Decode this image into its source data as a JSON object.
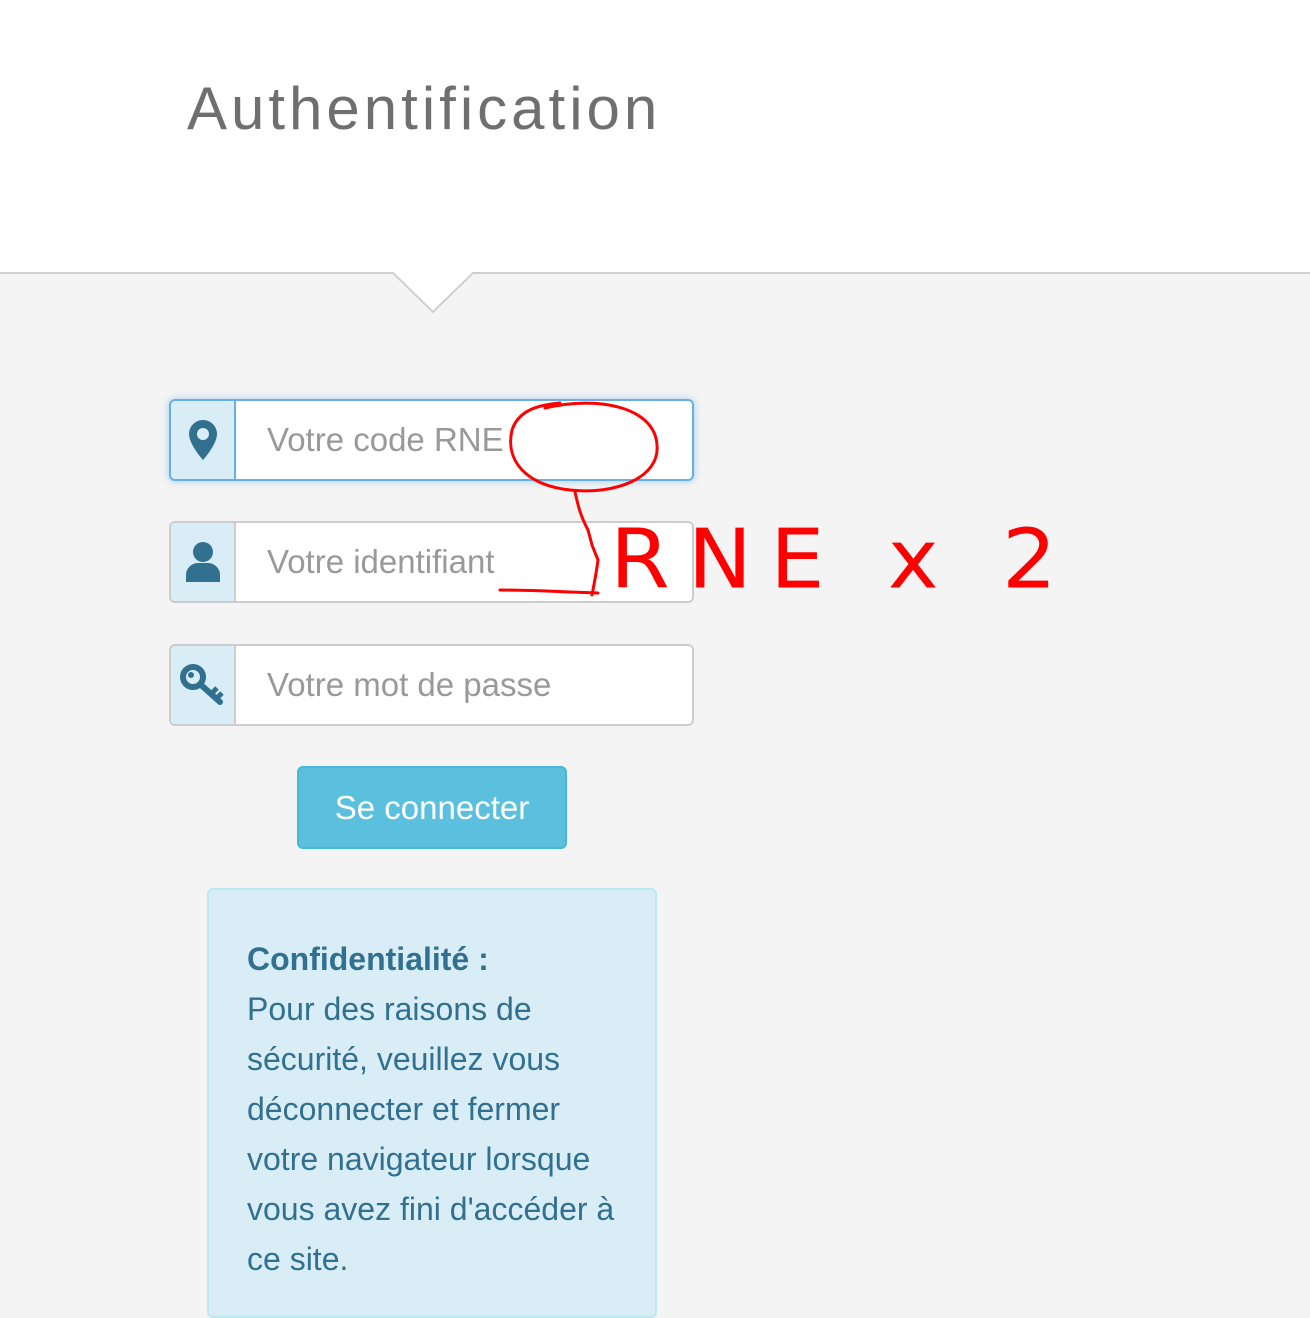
{
  "header": {
    "title": "Authentification"
  },
  "form": {
    "rne": {
      "placeholder": "Votre code RNE",
      "icon": "map-marker-icon"
    },
    "identifiant": {
      "placeholder": "Votre identifiant",
      "icon": "user-icon"
    },
    "password": {
      "placeholder": "Votre mot de passe",
      "icon": "key-icon"
    },
    "submit_label": "Se connecter"
  },
  "info": {
    "title": "Confidentialité :",
    "body": "Pour des raisons de sécurité, veuillez vous déconnecter et fermer votre navigateur lorsque vous avez fini d'accéder à ce site."
  },
  "annotation": {
    "text": "RNE x 2",
    "color": "#ff0000"
  },
  "colors": {
    "addon_bg": "#d9edf7",
    "icon": "#31708f",
    "button": "#5bc0de",
    "info_text": "#31708f"
  }
}
